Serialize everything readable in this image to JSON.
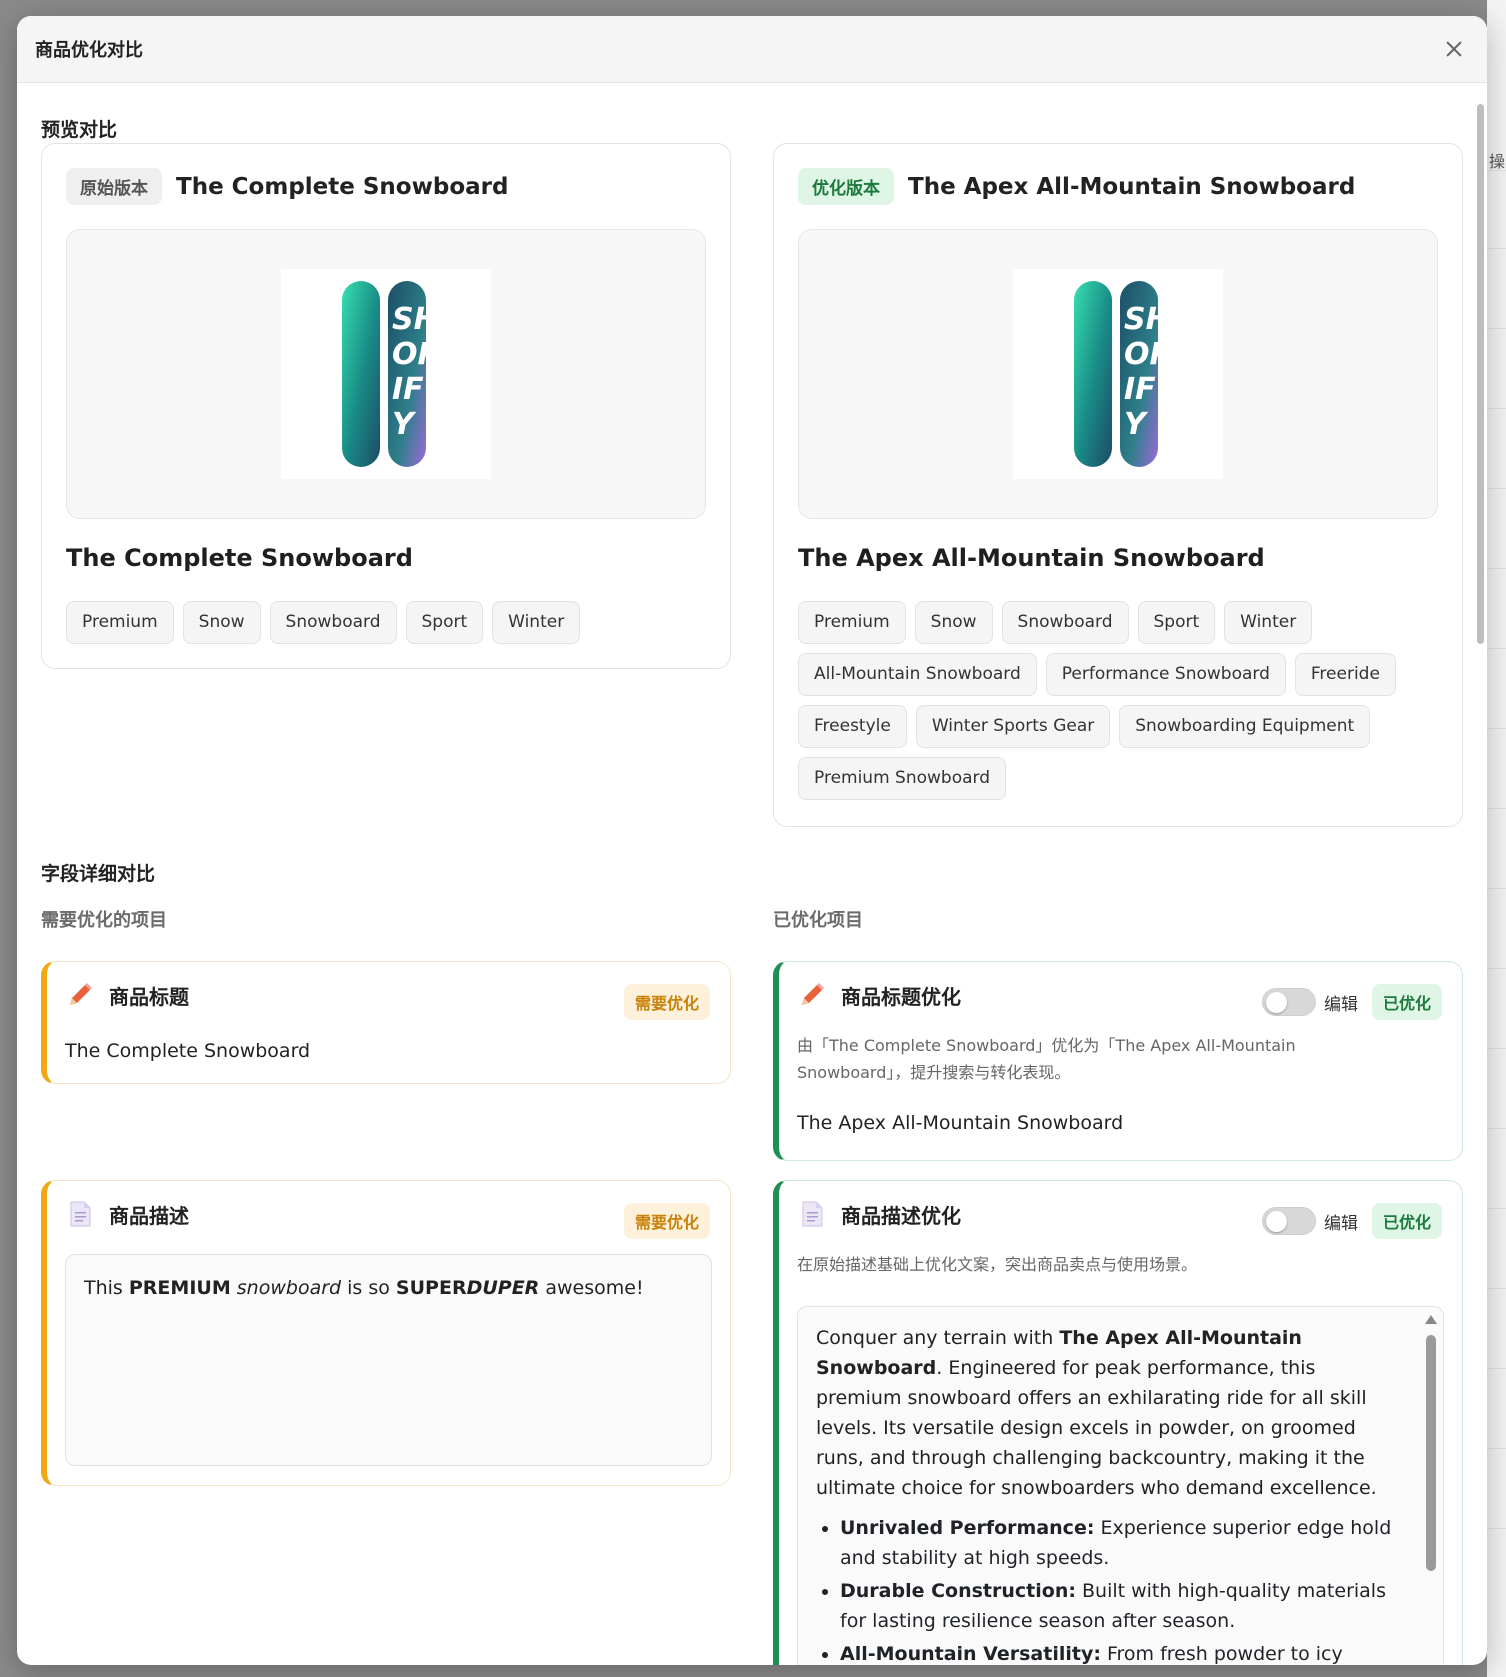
{
  "modal": {
    "title": "商品优化对比",
    "bg_char": "操"
  },
  "preview": {
    "section_title": "预览对比",
    "original": {
      "badge": "原始版本",
      "head_title": "The Complete Snowboard",
      "product_name": "The Complete Snowboard",
      "tags": [
        "Premium",
        "Snow",
        "Snowboard",
        "Sport",
        "Winter"
      ]
    },
    "optimized": {
      "badge": "优化版本",
      "head_title": "The Apex All-Mountain Snowboard",
      "product_name": "The Apex All-Mountain Snowboard",
      "tags": [
        "Premium",
        "Snow",
        "Snowboard",
        "Sport",
        "Winter",
        "All-Mountain Snowboard",
        "Performance Snowboard",
        "Freeride",
        "Freestyle",
        "Winter Sports Gear",
        "Snowboarding Equipment",
        "Premium Snowboard"
      ]
    }
  },
  "fields": {
    "section_title": "字段详细对比",
    "needs_title": "需要优化的项目",
    "done_title": "已优化项目",
    "title_original": {
      "label": "商品标题",
      "badge": "需要优化",
      "value": "The Complete Snowboard"
    },
    "title_optimized": {
      "label": "商品标题优化",
      "edit": "编辑",
      "badge": "已优化",
      "note": "由「The Complete Snowboard」优化为「The Apex All-Mountain Snowboard」，提升搜索与转化表现。",
      "value": "The Apex All-Mountain Snowboard"
    },
    "desc_original": {
      "label": "商品描述",
      "badge": "需要优化",
      "text_parts": [
        "This ",
        "PREMIUM",
        " ",
        "snowboard",
        " is so ",
        "SUPER",
        "DUPER",
        " awesome!"
      ]
    },
    "desc_optimized": {
      "label": "商品描述优化",
      "edit": "编辑",
      "badge": "已优化",
      "note": "在原始描述基础上优化文案，突出商品卖点与使用场景。",
      "intro_before": "Conquer any terrain with ",
      "intro_bold": "The Apex All-Mountain Snowboard",
      "intro_after": ". Engineered for peak performance, this premium snowboard offers an exhilarating ride for all skill levels. Its versatile design excels in powder, on groomed runs, and through challenging backcountry, making it the ultimate choice for snowboarders who demand excellence.",
      "bullets": [
        {
          "bold": "Unrivaled Performance:",
          "text": " Experience superior edge hold and stability at high speeds."
        },
        {
          "bold": "Durable Construction:",
          "text": " Built with high-quality materials for lasting resilience season after season."
        },
        {
          "bold": "All-Mountain Versatility:",
          "text": " From fresh powder to icy slopes,"
        }
      ]
    }
  },
  "colors": {
    "needs_accent": "#f0a914",
    "done_accent": "#1f8f55"
  }
}
